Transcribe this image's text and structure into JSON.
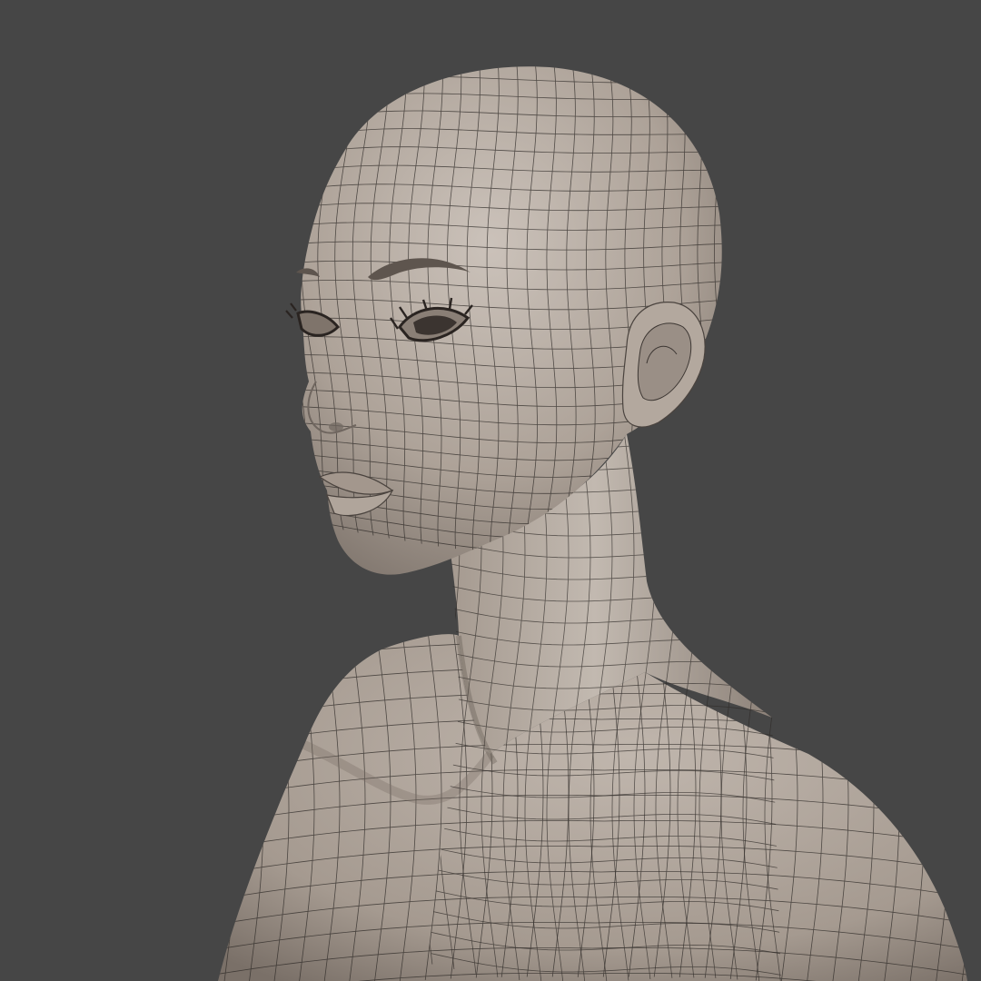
{
  "viewport": {
    "background": "#464646"
  },
  "model": {
    "subject": "bust-wireframe-mesh",
    "colors": {
      "skin_light": "#c4bab1",
      "skin_mid": "#a99e94",
      "skin_dark": "#6f665f",
      "wire": "#2e2a27",
      "brow": "#5e554e",
      "eye_dark": "#2a2421"
    },
    "display": {
      "wireframe_overlay": true,
      "shading": "matcap-clay"
    }
  }
}
